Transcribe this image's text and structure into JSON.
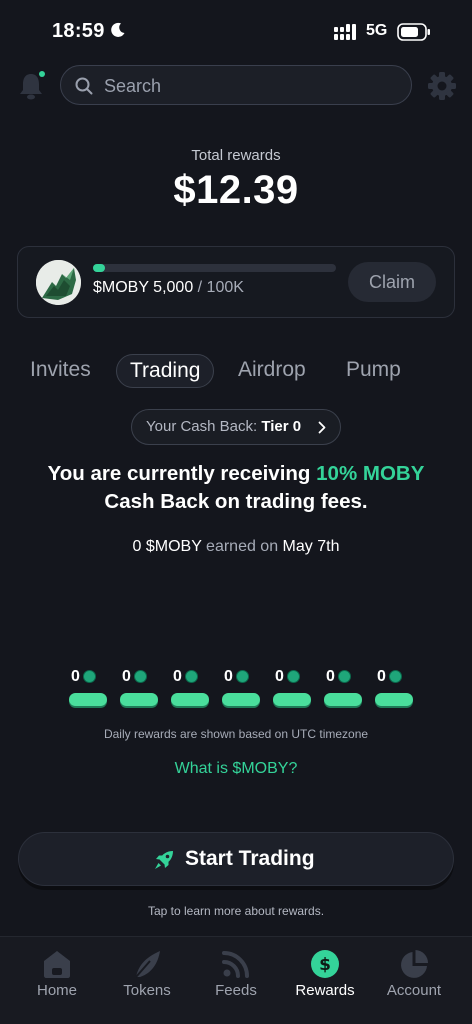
{
  "status_bar": {
    "time": "18:59",
    "network": "5G"
  },
  "header": {
    "search_placeholder": "Search"
  },
  "rewards": {
    "total_label": "Total rewards",
    "total_value": "$12.39"
  },
  "progress": {
    "amount": "$MOBY 5,000",
    "goal": " / 100K",
    "fraction": 0.05,
    "claim_label": "Claim"
  },
  "tabs": [
    {
      "label": "Invites",
      "active": false
    },
    {
      "label": "Trading",
      "active": true
    },
    {
      "label": "Airdrop",
      "active": false
    },
    {
      "label": "Pump",
      "active": false
    }
  ],
  "cashback": {
    "pill_prefix": "Your Cash Back: ",
    "tier": "Tier 0",
    "line1_pre": "You are currently receiving ",
    "line1_highlight": "10% MOBY",
    "line2": "Cash Back on trading fees.",
    "earned_amount": "0 $MOBY",
    "earned_mid": " earned on ",
    "earned_date": "May 7th"
  },
  "daily": {
    "values": [
      "0",
      "0",
      "0",
      "0",
      "0",
      "0",
      "0"
    ],
    "note": "Daily rewards are shown based on UTC timezone",
    "link": "What is $MOBY?"
  },
  "cta": {
    "label": "Start Trading",
    "note": "Tap to learn more about rewards."
  },
  "nav": {
    "items": [
      {
        "label": "Home",
        "icon": "home-icon"
      },
      {
        "label": "Tokens",
        "icon": "tokens-icon"
      },
      {
        "label": "Feeds",
        "icon": "feeds-icon"
      },
      {
        "label": "Rewards",
        "icon": "rewards-icon"
      },
      {
        "label": "Account",
        "icon": "account-icon"
      }
    ],
    "active_index": 3
  },
  "colors": {
    "background": "#14161d",
    "accent": "#34d399",
    "muted": "#9ea3ae"
  }
}
